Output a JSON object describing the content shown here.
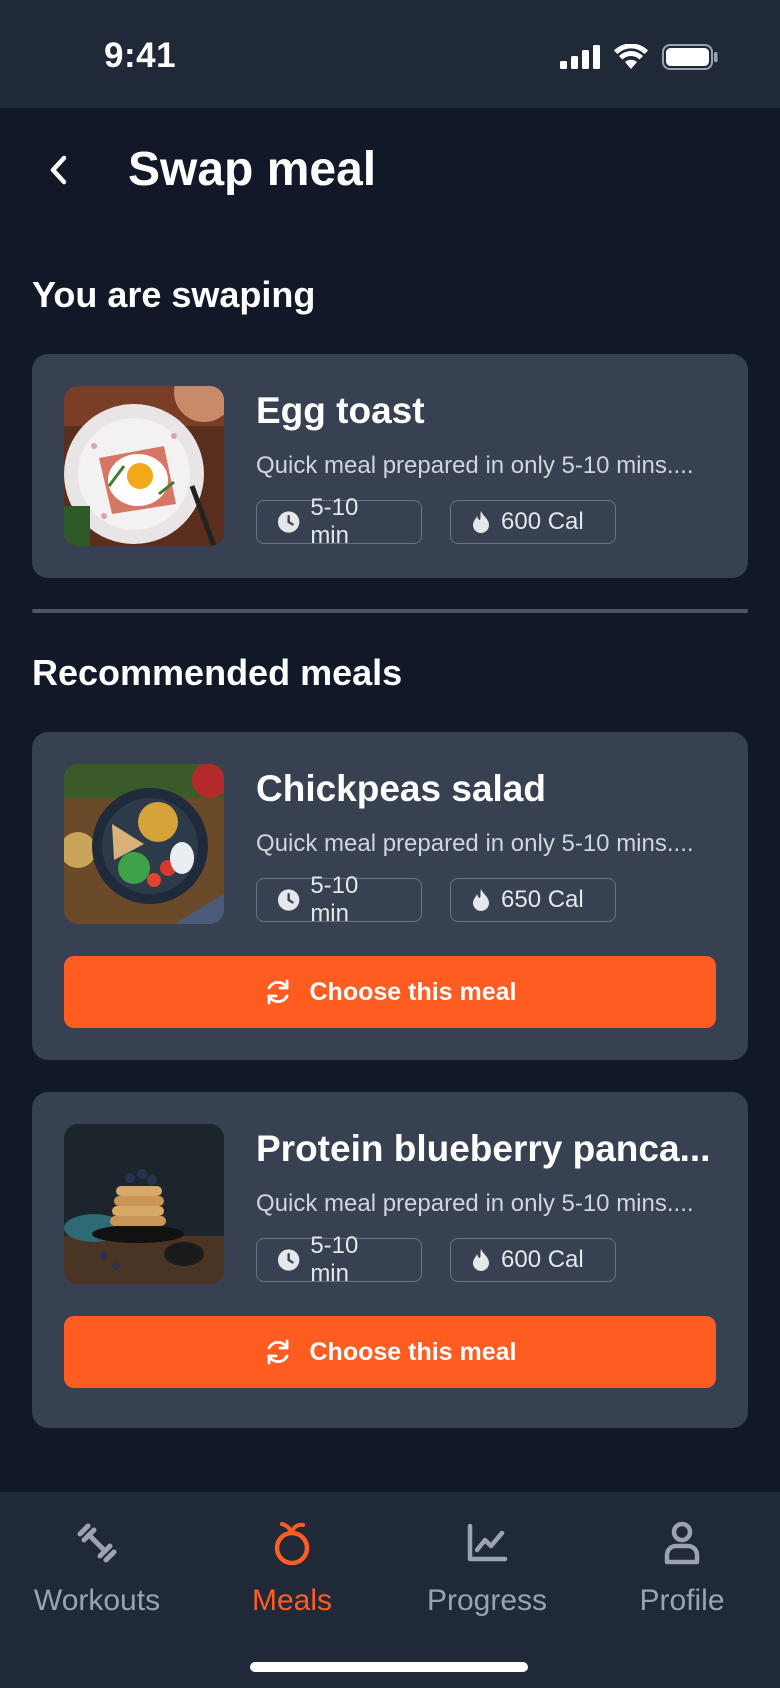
{
  "status_bar": {
    "time": "9:41"
  },
  "header": {
    "title": "Swap meal"
  },
  "current_section": {
    "title": "You are swaping",
    "meal": {
      "name": "Egg toast",
      "description": "Quick meal prepared in only 5-10 mins....",
      "time": "5-10 min",
      "calories": "600 Cal"
    }
  },
  "recommended_section": {
    "title": "Recommended meals",
    "meals": [
      {
        "name": "Chickpeas salad",
        "description": "Quick meal prepared in only 5-10 mins....",
        "time": "5-10 min",
        "calories": "650 Cal",
        "button_label": "Choose this meal"
      },
      {
        "name": "Protein blueberry panca...",
        "description": "Quick meal prepared in only 5-10 mins....",
        "time": "5-10 min",
        "calories": "600 Cal",
        "button_label": "Choose this meal"
      }
    ]
  },
  "bottom_nav": {
    "items": [
      {
        "label": "Workouts",
        "icon": "dumbbell-icon"
      },
      {
        "label": "Meals",
        "icon": "orange-fruit-icon",
        "active": true
      },
      {
        "label": "Progress",
        "icon": "chart-icon"
      },
      {
        "label": "Profile",
        "icon": "person-icon"
      }
    ]
  },
  "colors": {
    "background": "#111827",
    "card": "#374151",
    "accent": "#ff5c21",
    "nav_inactive": "#9ca3af"
  }
}
